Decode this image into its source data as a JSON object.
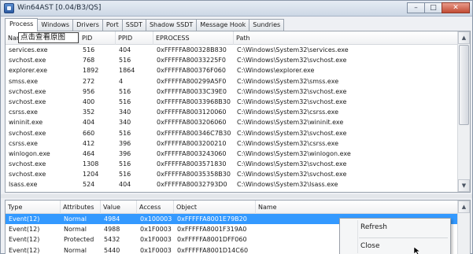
{
  "window": {
    "title": "Win64AST [0.04/B3/QS]",
    "minimize_glyph": "–",
    "maximize_glyph": "□",
    "close_glyph": "✕"
  },
  "tabs": [
    {
      "label": "Process",
      "active": true
    },
    {
      "label": "Windows"
    },
    {
      "label": "Drivers"
    },
    {
      "label": "Port"
    },
    {
      "label": "SSDT"
    },
    {
      "label": "Shadow SSDT"
    },
    {
      "label": "Message Hook"
    },
    {
      "label": "Sundries"
    }
  ],
  "overlay_label": "点击查看原图",
  "process_table": {
    "columns": [
      "Name",
      "PID",
      "PPID",
      "EPROCESS",
      "Path"
    ],
    "rows": [
      [
        "services.exe",
        "516",
        "404",
        "0xFFFFFA800328B830",
        "C:\\Windows\\System32\\services.exe"
      ],
      [
        "svchost.exe",
        "768",
        "516",
        "0xFFFFFA80033225F0",
        "C:\\Windows\\System32\\svchost.exe"
      ],
      [
        "explorer.exe",
        "1892",
        "1864",
        "0xFFFFFA800376F060",
        "C:\\Windows\\explorer.exe"
      ],
      [
        "smss.exe",
        "272",
        "4",
        "0xFFFFFA800299A5F0",
        "C:\\Windows\\System32\\smss.exe"
      ],
      [
        "svchost.exe",
        "956",
        "516",
        "0xFFFFFA80033C39E0",
        "C:\\Windows\\System32\\svchost.exe"
      ],
      [
        "svchost.exe",
        "400",
        "516",
        "0xFFFFFA80033968B30",
        "C:\\Windows\\System32\\svchost.exe"
      ],
      [
        "csrss.exe",
        "352",
        "340",
        "0xFFFFFA8003120060",
        "C:\\Windows\\System32\\csrss.exe"
      ],
      [
        "wininit.exe",
        "404",
        "340",
        "0xFFFFFA8003206060",
        "C:\\Windows\\System32\\wininit.exe"
      ],
      [
        "svchost.exe",
        "660",
        "516",
        "0xFFFFFA800346C7B30",
        "C:\\Windows\\System32\\svchost.exe"
      ],
      [
        "csrss.exe",
        "412",
        "396",
        "0xFFFFFA8003200210",
        "C:\\Windows\\System32\\csrss.exe"
      ],
      [
        "winlogon.exe",
        "464",
        "396",
        "0xFFFFFA8003243060",
        "C:\\Windows\\System32\\winlogon.exe"
      ],
      [
        "svchost.exe",
        "1308",
        "516",
        "0xFFFFFA8003571830",
        "C:\\Windows\\System32\\svchost.exe"
      ],
      [
        "svchost.exe",
        "1204",
        "516",
        "0xFFFFFA80035358B30",
        "C:\\Windows\\System32\\svchost.exe"
      ],
      [
        "lsass.exe",
        "524",
        "404",
        "0xFFFFFA80032793D0",
        "C:\\Windows\\System32\\lsass.exe"
      ]
    ]
  },
  "handle_table": {
    "columns": [
      "Type",
      "Attributes",
      "Value",
      "Access",
      "Object",
      "Name"
    ],
    "selected_row": 0,
    "rows": [
      [
        "Event(12)",
        "Normal",
        "4984",
        "0x100003",
        "0xFFFFFA8001E79B20",
        ""
      ],
      [
        "Event(12)",
        "Normal",
        "4988",
        "0x1F0003",
        "0xFFFFFA8001F319A0",
        ""
      ],
      [
        "Event(12)",
        "Protected",
        "5432",
        "0x1F0003",
        "0xFFFFFA8001DFF060",
        ""
      ],
      [
        "Event(12)",
        "Normal",
        "5440",
        "0x1F0003",
        "0xFFFFFA8001D14C60",
        ""
      ]
    ]
  },
  "context_menu": {
    "items": [
      "Refresh",
      "Close"
    ]
  },
  "colors": {
    "selection": "#3399ff",
    "titlebar": "#ccd7e5"
  }
}
